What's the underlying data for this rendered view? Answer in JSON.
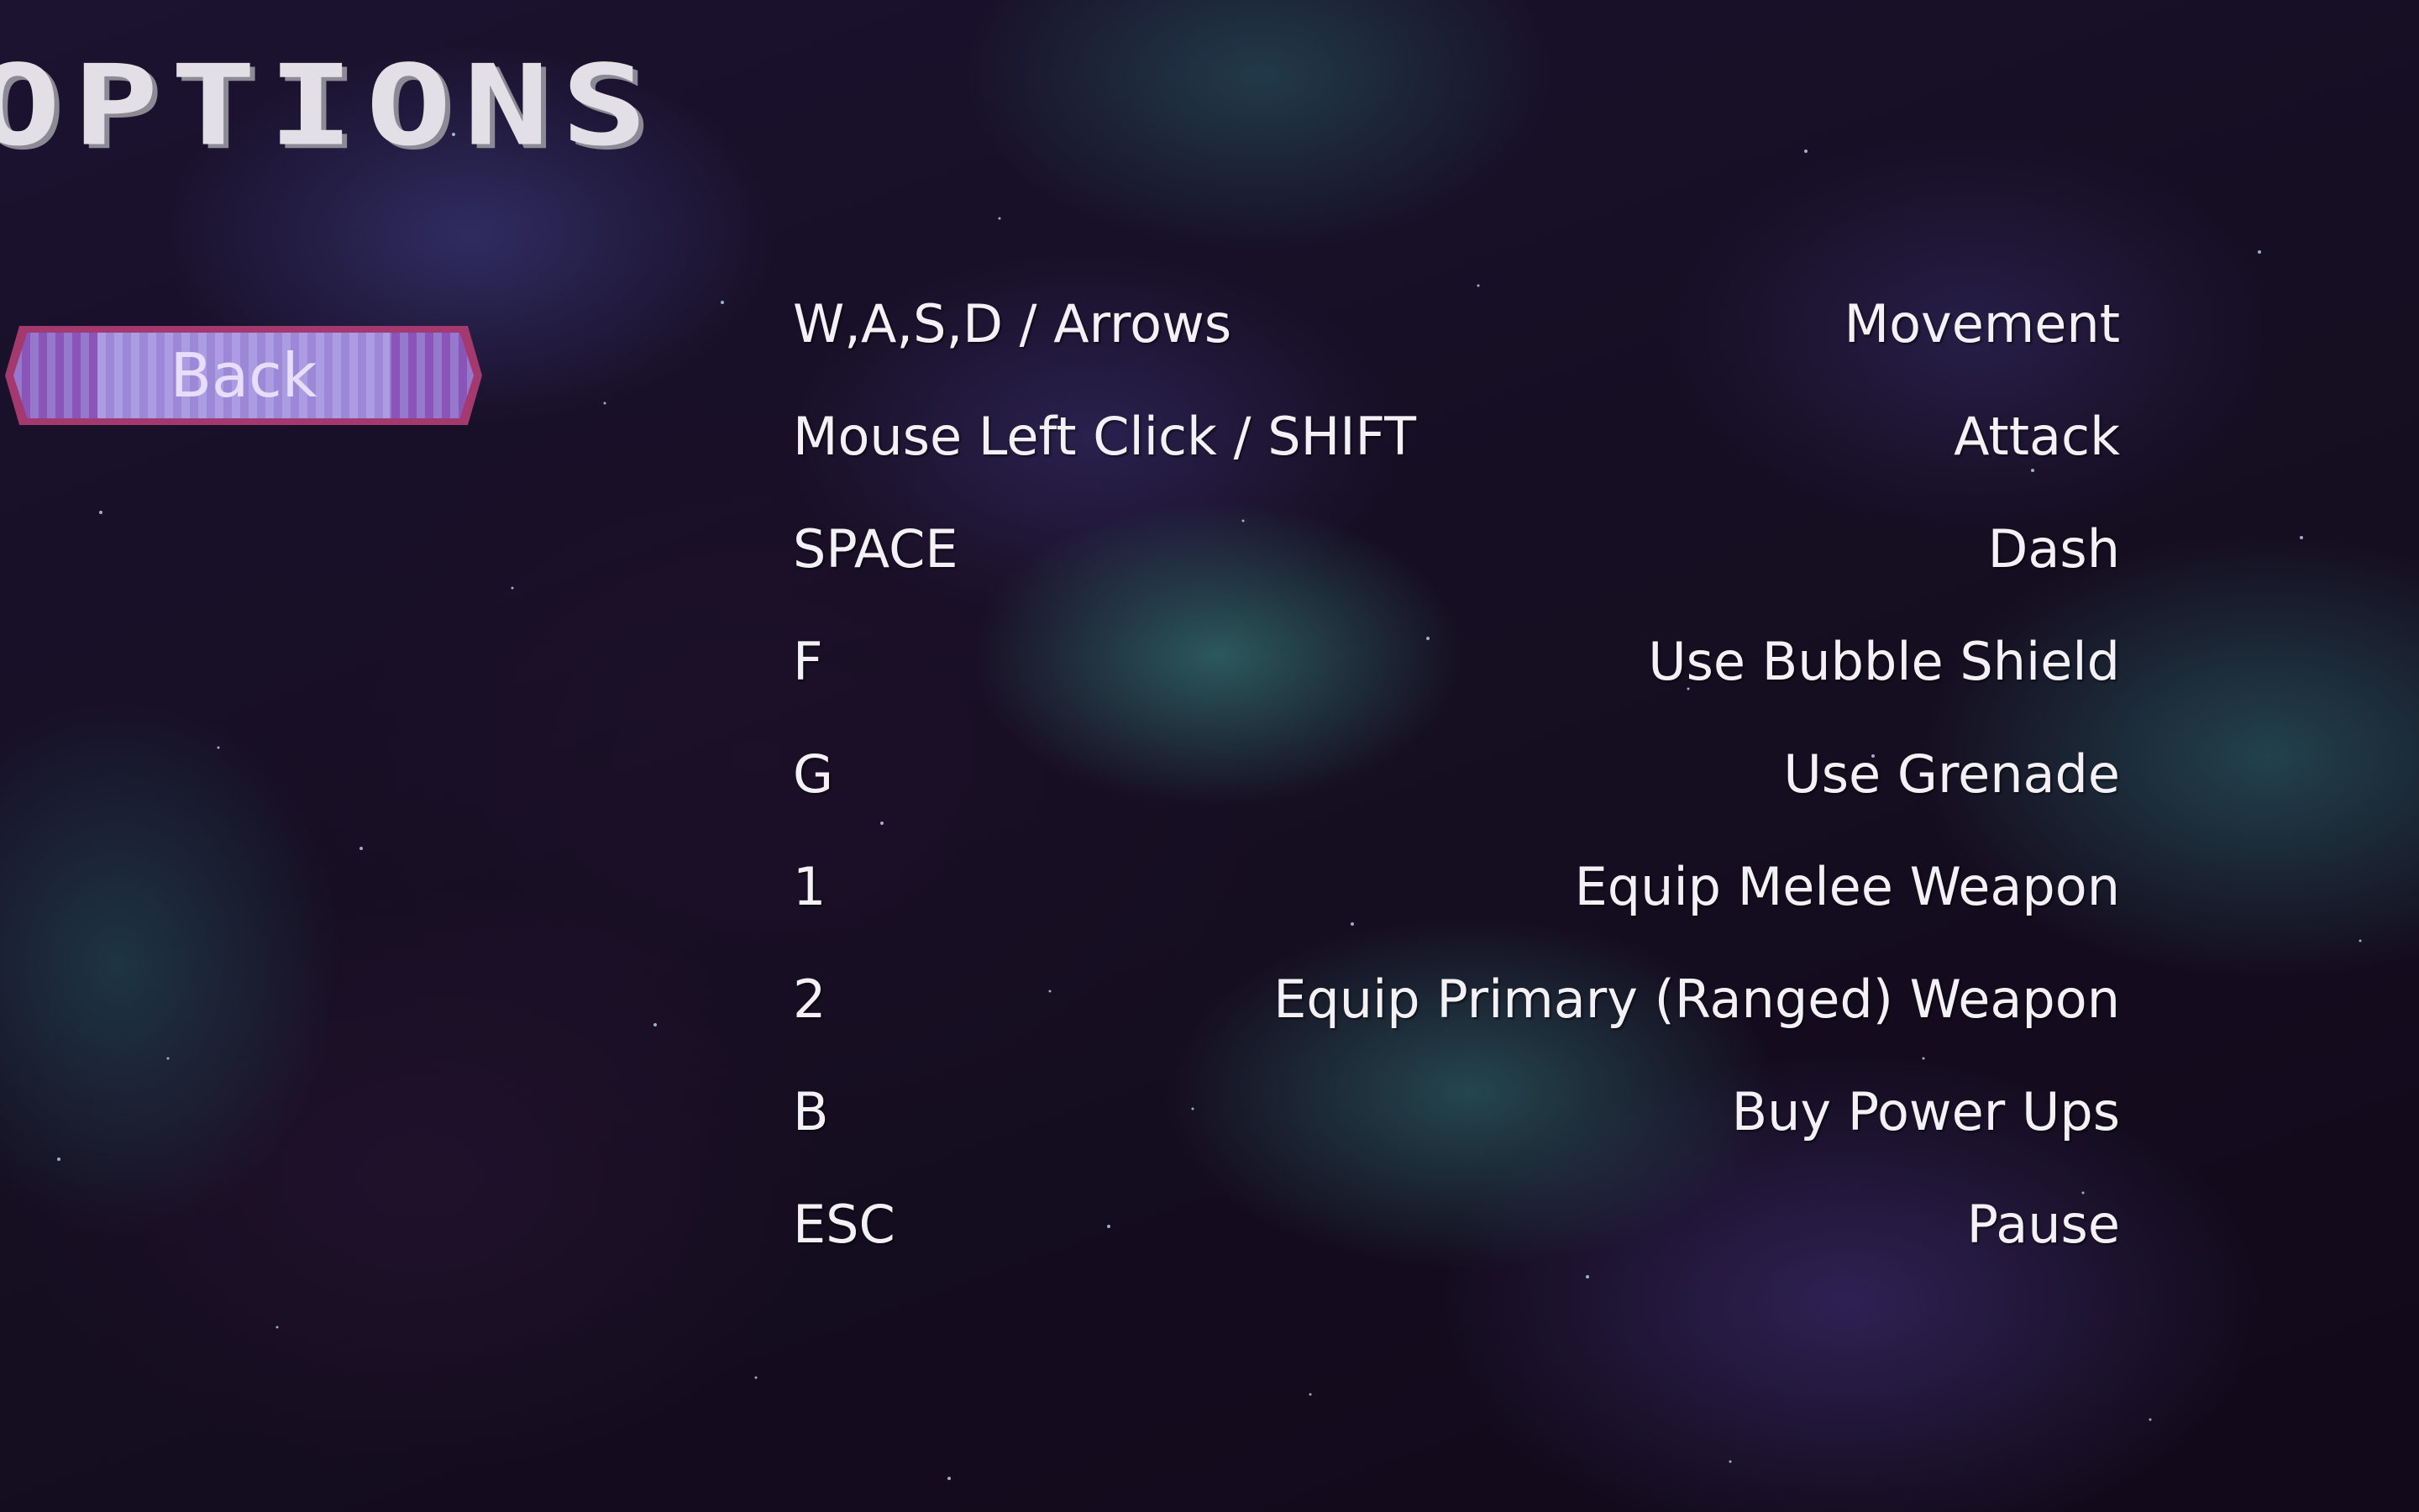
{
  "screen": {
    "title": "OPTIONS"
  },
  "back_button": {
    "label": "Back"
  },
  "controls": [
    {
      "key": "W,A,S,D / Arrows",
      "action": "Movement"
    },
    {
      "key": "Mouse Left Click / SHIFT",
      "action": "Attack"
    },
    {
      "key": "SPACE",
      "action": "Dash"
    },
    {
      "key": "F",
      "action": "Use Bubble Shield"
    },
    {
      "key": "G",
      "action": "Use Grenade"
    },
    {
      "key": "1",
      "action": "Equip Melee Weapon"
    },
    {
      "key": "2",
      "action": "Equip Primary (Ranged) Weapon"
    },
    {
      "key": "B",
      "action": "Buy Power Ups"
    },
    {
      "key": "ESC",
      "action": "Pause"
    }
  ],
  "colors": {
    "background": "#130c1c",
    "title_text": "#e2e0e6",
    "button_border": "#a3396f",
    "button_fill": "#8a55b8",
    "button_text": "#e6defa",
    "control_text": "#f3f1f5"
  }
}
